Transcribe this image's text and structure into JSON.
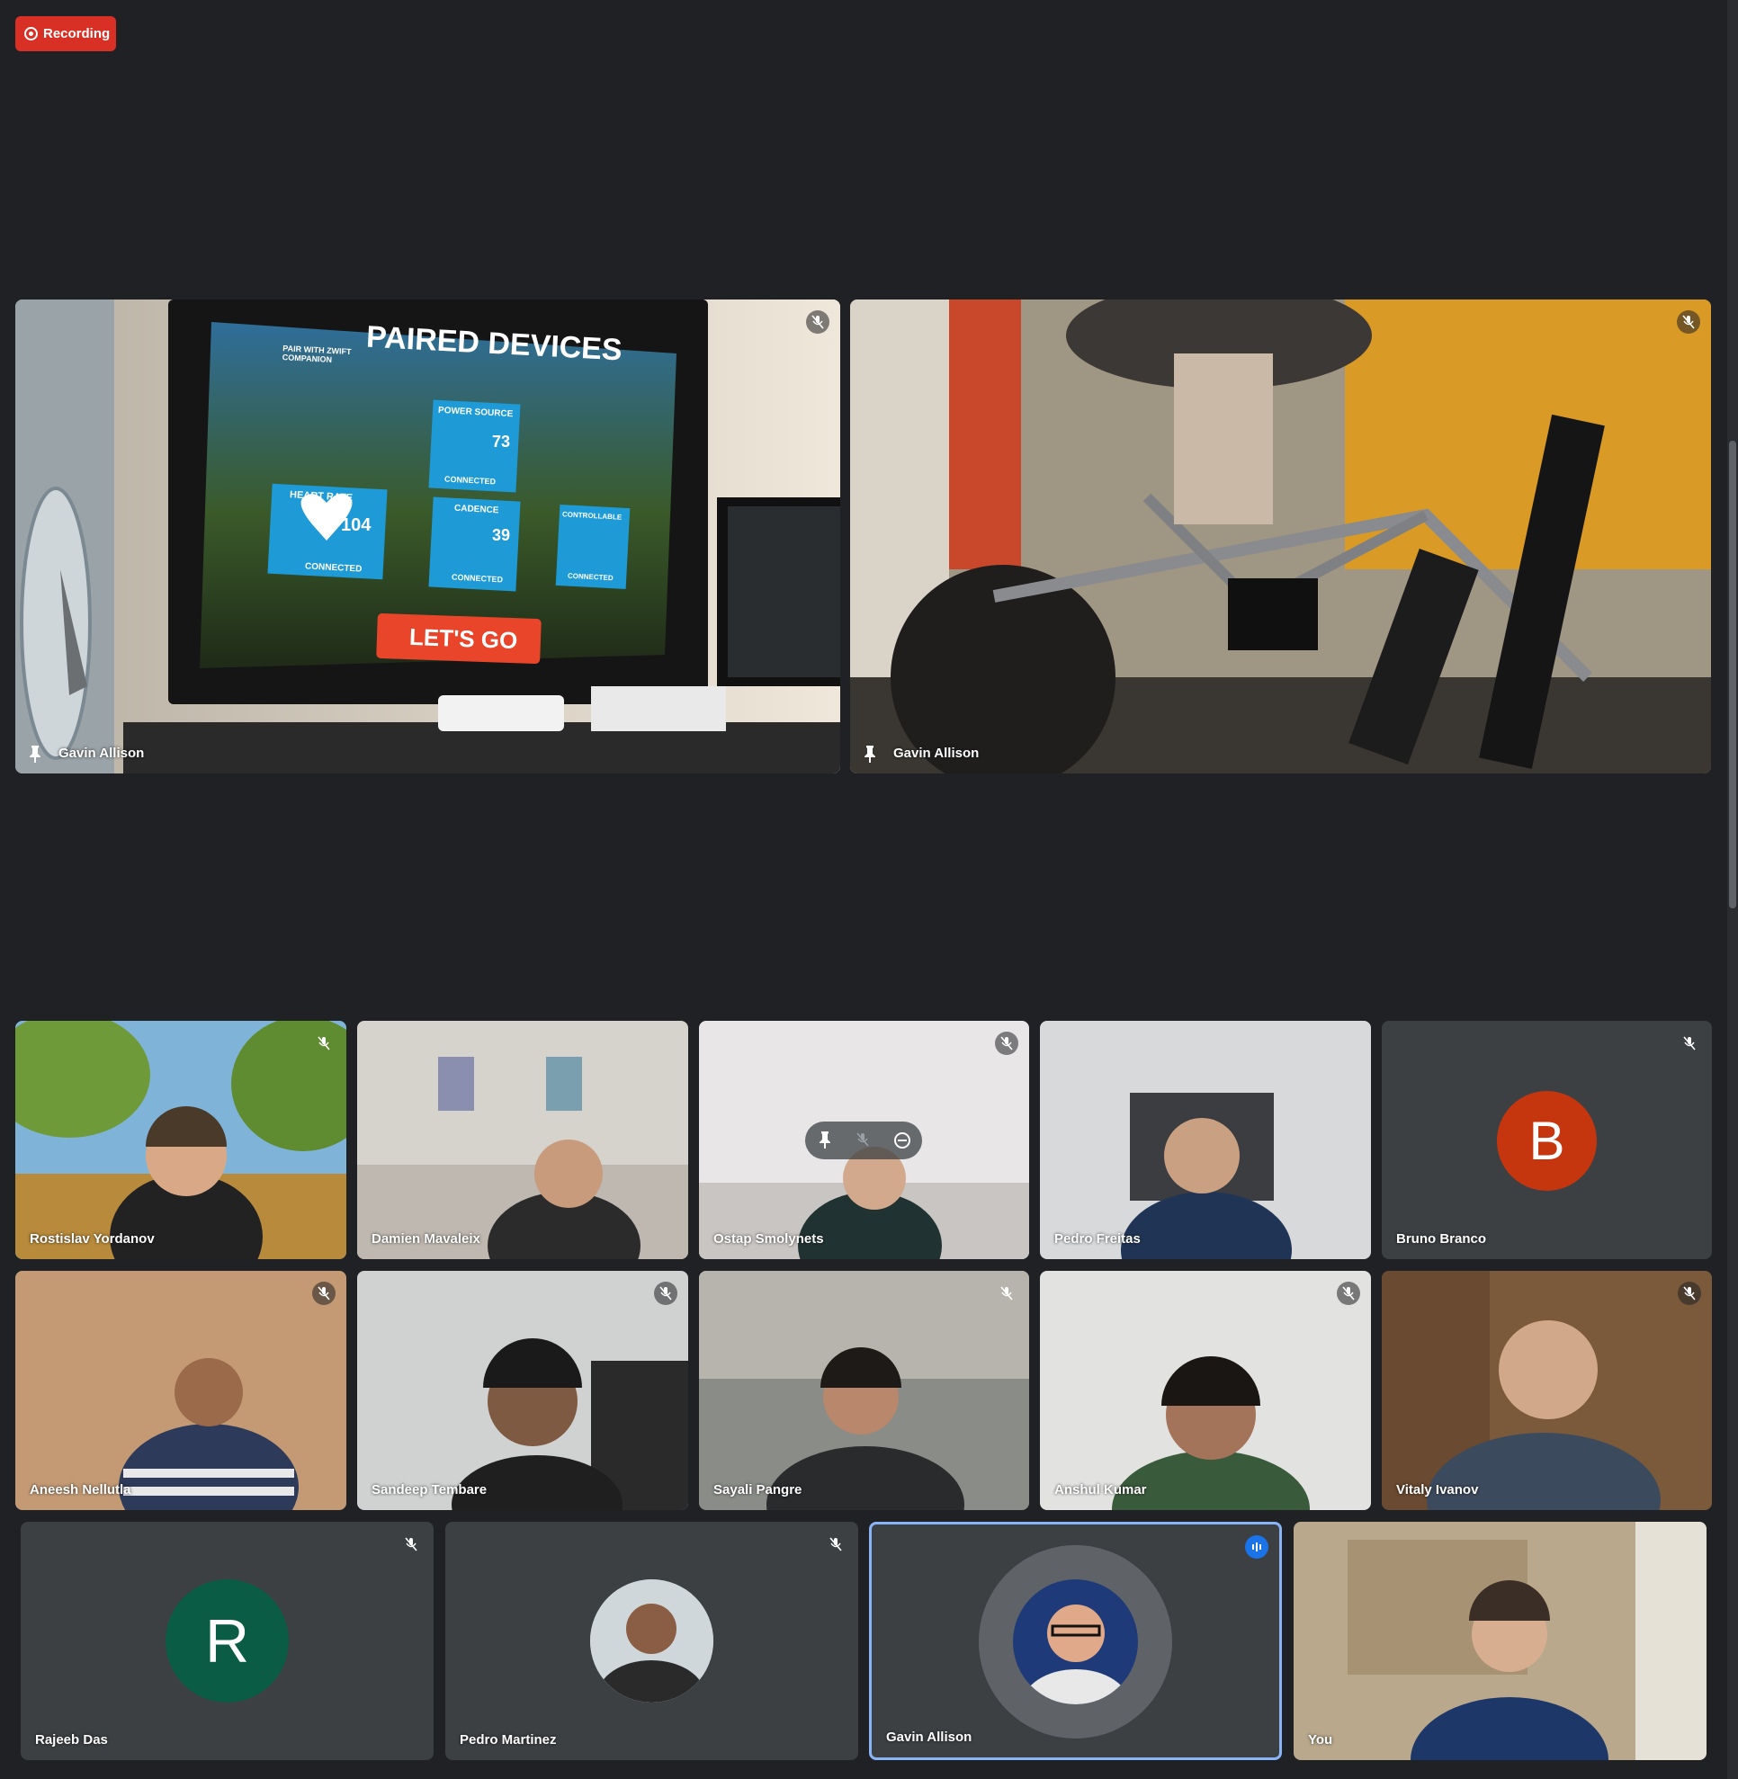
{
  "recording": {
    "label": "Recording"
  },
  "presenters": [
    {
      "name": "Gavin Allison"
    },
    {
      "name": "Gavin Allison"
    }
  ],
  "screen": {
    "title": "PAIRED DEVICES",
    "subtitle": "PAIR WITH ZWIFT COMPANION",
    "devices": [
      {
        "label": "POWER SOURCE",
        "value": "73",
        "status": "CONNECTED"
      },
      {
        "label": "HEART RATE",
        "value": "104",
        "status": "CONNECTED"
      },
      {
        "label": "CADENCE",
        "value": "39",
        "status": "CONNECTED"
      },
      {
        "label": "CONTROLLABLE",
        "value": "",
        "status": "CONNECTED"
      }
    ],
    "button": "LET'S GO"
  },
  "participants_row1": [
    {
      "name": "Rostislav Yordanov"
    },
    {
      "name": "Damien Mavaleix"
    },
    {
      "name": "Ostap Smolynets"
    },
    {
      "name": "Pedro Freitas"
    },
    {
      "name": "Bruno Branco",
      "initial": "B"
    }
  ],
  "participants_row2": [
    {
      "name": "Aneesh Nellutla"
    },
    {
      "name": "Sandeep Tembare"
    },
    {
      "name": "Sayali Pangre"
    },
    {
      "name": "Anshul Kumar"
    },
    {
      "name": "Vitaly Ivanov"
    }
  ],
  "participants_row3": [
    {
      "name": "Rajeeb Das",
      "initial": "R"
    },
    {
      "name": "Pedro Martinez"
    },
    {
      "name": "Gavin Allison"
    },
    {
      "name": "You"
    }
  ],
  "colors": {
    "background": "#202124",
    "tile": "#3c4043",
    "recording": "#d93025",
    "bruno_avatar": "#c5360f",
    "rajeeb_avatar": "#0b5c45",
    "active_speaker": "#8ab4f8"
  }
}
